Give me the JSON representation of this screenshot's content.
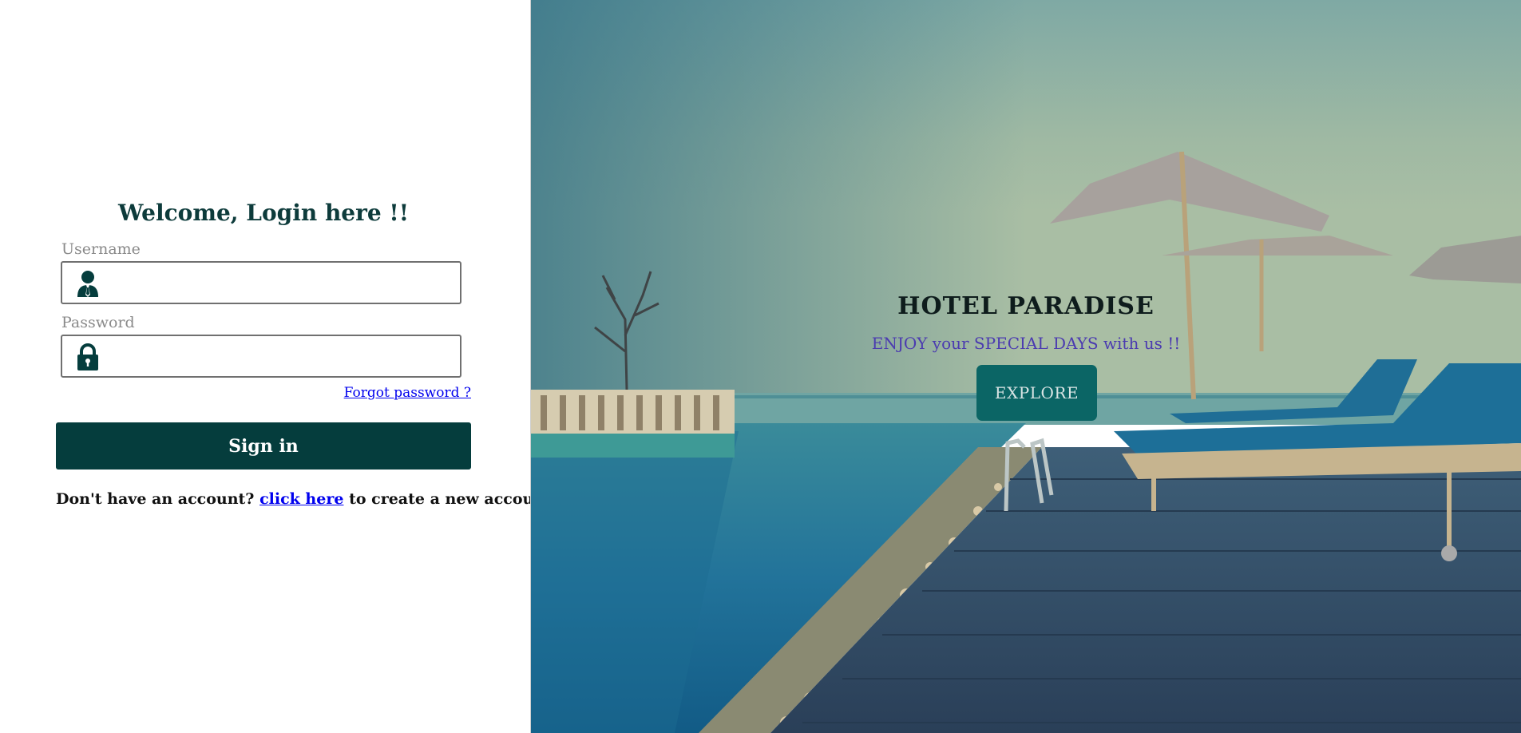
{
  "login": {
    "title": "Welcome, Login here !!",
    "username_label": "Username",
    "username_value": "",
    "password_label": "Password",
    "password_value": "",
    "forgot_link": "Forgot password ?",
    "signin_label": "Sign in",
    "signup_prefix": "Don't have an account?",
    "signup_link": "click here",
    "signup_suffix": "to create a new account."
  },
  "hero": {
    "title": "HOTEL PARADISE",
    "subtitle": "ENJOY your SPECIAL DAYS with us !!",
    "explore_label": "EXPLORE"
  },
  "colors": {
    "brand_dark": "#053d3d",
    "explore_bg": "#0b6565",
    "subtitle": "#4b3bb0",
    "link": "#0000ee"
  },
  "icons": {
    "username": "user-tie-icon",
    "password": "lock-icon"
  }
}
